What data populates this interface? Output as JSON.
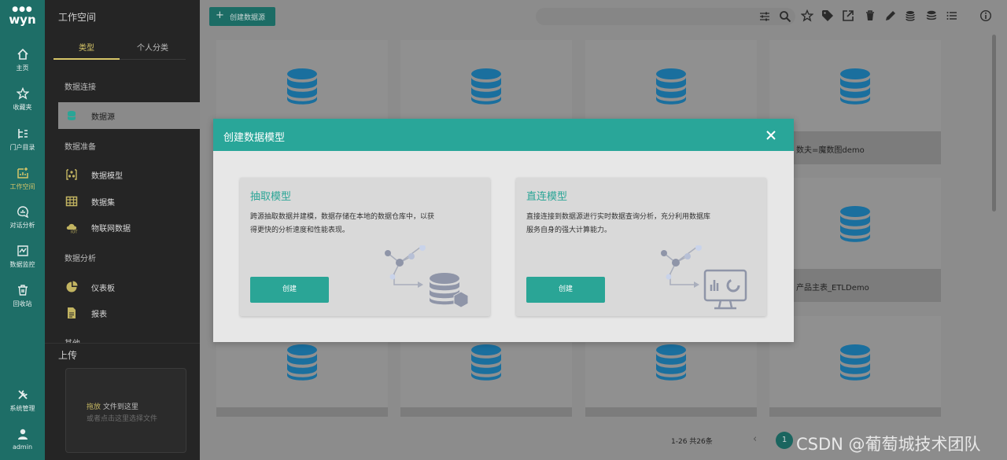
{
  "rail": {
    "logo_text": "wyn",
    "items": [
      {
        "label": "主页",
        "icon": "home-icon"
      },
      {
        "label": "收藏夹",
        "icon": "star-icon"
      },
      {
        "label": "门户目录",
        "icon": "portal-icon"
      },
      {
        "label": "工作空间",
        "icon": "workspace-icon"
      },
      {
        "label": "对话分析",
        "icon": "chat-analysis-icon"
      },
      {
        "label": "数据监控",
        "icon": "monitor-icon"
      },
      {
        "label": "回收站",
        "icon": "trash-icon"
      }
    ],
    "bottom": [
      {
        "label": "系统管理",
        "icon": "tools-icon"
      },
      {
        "label": "admin",
        "icon": "user-icon"
      }
    ]
  },
  "panel": {
    "title": "工作空间",
    "tabs": [
      "类型",
      "个人分类"
    ],
    "sections": {
      "connect": "数据连接",
      "prepare": "数据准备",
      "analyze": "数据分析",
      "other": "其他"
    },
    "items": {
      "datasource": "数据源",
      "datamodel": "数据模型",
      "dataset": "数据集",
      "iot": "物联网数据",
      "dashboard": "仪表板",
      "report": "报表"
    },
    "upload": {
      "title": "上传",
      "drag_highlight": "拖放",
      "drag_rest": "文件到这里",
      "hint": "或者点击这里选择文件"
    }
  },
  "toolbar": {
    "create_datasource": "创建数据源",
    "plus": "+"
  },
  "cards": {
    "caption_r1c4": "数夫=魔数图demo",
    "caption_r2c4": "产品主表_ETLDemo"
  },
  "pager": {
    "summary": "1-26 共26条",
    "prev": "‹",
    "current": "1"
  },
  "watermark": "CSDN @葡萄城技术团队",
  "modal": {
    "title": "创建数据模型",
    "close": "×",
    "options": [
      {
        "title": "抽取模型",
        "desc": "跨源抽取数据并建模，数据存储在本地的数据仓库中，以获得更快的分析速度和性能表现。",
        "button": "创建"
      },
      {
        "title": "直连模型",
        "desc": "直接连接到数据源进行实时数据查询分析，充分利用数据库服务自身的强大计算能力。",
        "button": "创建"
      }
    ]
  },
  "colors": {
    "accent": "#2aa596",
    "rail_bg": "#1e6e67",
    "active_yellow": "#d6c568",
    "db_blue": "#1a6f9e"
  }
}
